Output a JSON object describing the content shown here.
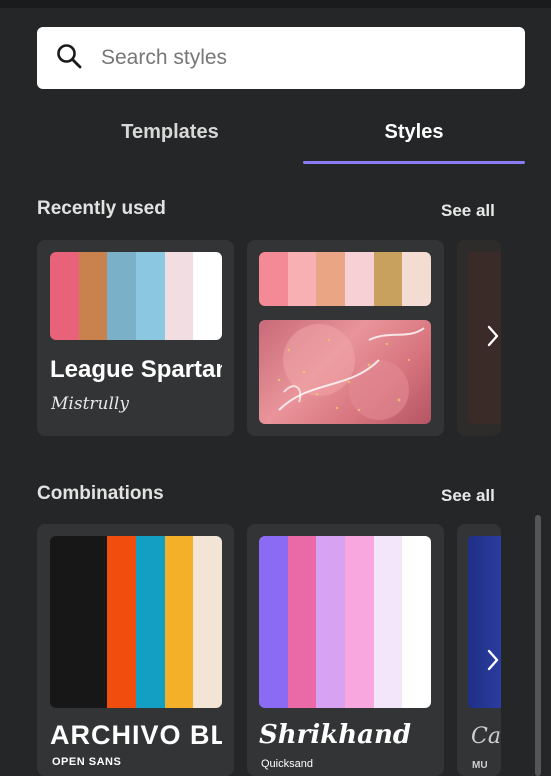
{
  "search": {
    "placeholder": "Search styles"
  },
  "tabs": [
    {
      "label": "Templates"
    },
    {
      "label": "Styles"
    }
  ],
  "recent": {
    "title": "Recently used",
    "see_all": "See all",
    "cards": [
      {
        "palette": [
          "#e8637a",
          "#c9814e",
          "#7ab0c8",
          "#8cc7e2",
          "#f1dde2",
          "#ffffff"
        ],
        "heading_font": "League Spartan",
        "subtitle_font": "Mistrully"
      },
      {
        "palette": [
          "#f48a95",
          "#f8b0b2",
          "#eaa585",
          "#f6d0d4",
          "#c8a15f",
          "#f3ddd2"
        ]
      }
    ]
  },
  "combinations": {
    "title": "Combinations",
    "see_all": "See all",
    "cards": [
      {
        "palette": [
          "#171717",
          "#171717",
          "#f04d0f",
          "#139fc4",
          "#f5b029",
          "#f3e5d5"
        ],
        "heading_font": "ARCHIVO BLACK",
        "subtitle_font": "OPEN SANS"
      },
      {
        "palette": [
          "#8b6bf3",
          "#e96aa6",
          "#d8a2f2",
          "#f8a8de",
          "#f3e6fa",
          "#ffffff"
        ],
        "heading_font": "Shrikhand",
        "subtitle_font": "Quicksand"
      },
      {
        "heading_font": "Ca",
        "subtitle_font": "MU"
      }
    ]
  }
}
